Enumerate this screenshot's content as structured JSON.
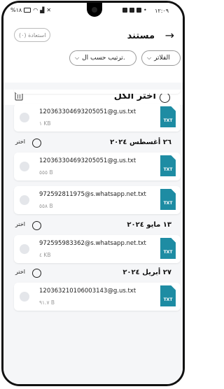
{
  "status_bar": {
    "time": "١٢:٠٩",
    "battery": "%١٨"
  },
  "header": {
    "title": "مستند",
    "restore_label": "استعادة (٠)"
  },
  "filters": {
    "filters_label": "الفلاتر",
    "sort_label": "ترتيب حسب ال."
  },
  "select_all": {
    "label": "اختر الكل"
  },
  "groups": [
    {
      "date": "٢٦ أغسطس ٢٠٢٤",
      "choose_label": "اختر"
    },
    {
      "date": "١٣ مايو ٢٠٢٤",
      "choose_label": "اختر"
    },
    {
      "date": "٢٧ أبريل ٢٠٢٤",
      "choose_label": "اختر"
    }
  ],
  "files": [
    {
      "name": "120363304693205051@g.us.txt",
      "size": "١ KB",
      "type": "TXT"
    },
    {
      "name": "120363304693205051@g.us.txt",
      "size": "٥٥٥ B",
      "type": "TXT"
    },
    {
      "name": "972592811975@s.whatsapp.net.txt",
      "size": "٥٥٨ B",
      "type": "TXT"
    },
    {
      "name": "972595983362@s.whatsapp.net.txt",
      "size": "٤ KB",
      "type": "TXT"
    },
    {
      "name": "120363210106003143@g.us.txt",
      "size": "٩١.٧ B",
      "type": "TXT"
    }
  ],
  "colors": {
    "accent": "#1e8ca3",
    "background": "#f5f6f8"
  }
}
